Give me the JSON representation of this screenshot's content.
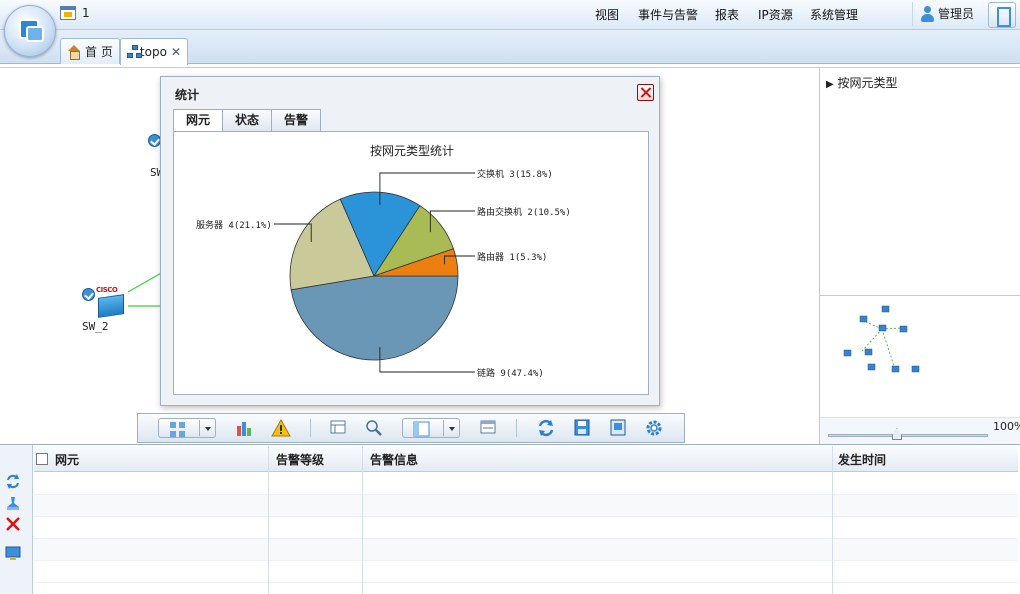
{
  "header": {
    "counter": "1",
    "menu": [
      "视图",
      "事件与告警",
      "报表",
      "IP资源",
      "系统管理"
    ],
    "user": "管理员"
  },
  "tabs": [
    {
      "label": "首 页"
    },
    {
      "label": "topo"
    }
  ],
  "topology": {
    "nodes": [
      {
        "label": "SW_2"
      },
      {
        "label": "SW"
      }
    ],
    "switch_brand": "CISCO"
  },
  "stats_dialog": {
    "title": "统计",
    "tabs": [
      "网元",
      "状态",
      "告警"
    ],
    "chart_title": "按网元类型统计"
  },
  "chart_data": {
    "type": "pie",
    "title": "按网元类型统计",
    "series": [
      {
        "label": "链路 9(47.4%)",
        "value": 9,
        "percent": 47.4,
        "color": "#6a97b5"
      },
      {
        "label": "服务器 4(21.1%)",
        "value": 4,
        "percent": 21.1,
        "color": "#c9c99a"
      },
      {
        "label": "交换机 3(15.8%)",
        "value": 3,
        "percent": 15.8,
        "color": "#2b93d8"
      },
      {
        "label": "路由交换机 2(10.5%)",
        "value": 2,
        "percent": 10.5,
        "color": "#a8bb55"
      },
      {
        "label": "路由器 1(5.3%)",
        "value": 1,
        "percent": 5.3,
        "color": "#ec7f10"
      }
    ]
  },
  "right_panel": {
    "tree_root": "按网元类型",
    "zoom": "100%"
  },
  "alarm_table": {
    "columns": [
      "网元",
      "告警等级",
      "告警信息",
      "发生时间"
    ],
    "rows": []
  },
  "colors": {
    "accent": "#3d8fdb",
    "link_line": "#3ccf3c"
  }
}
